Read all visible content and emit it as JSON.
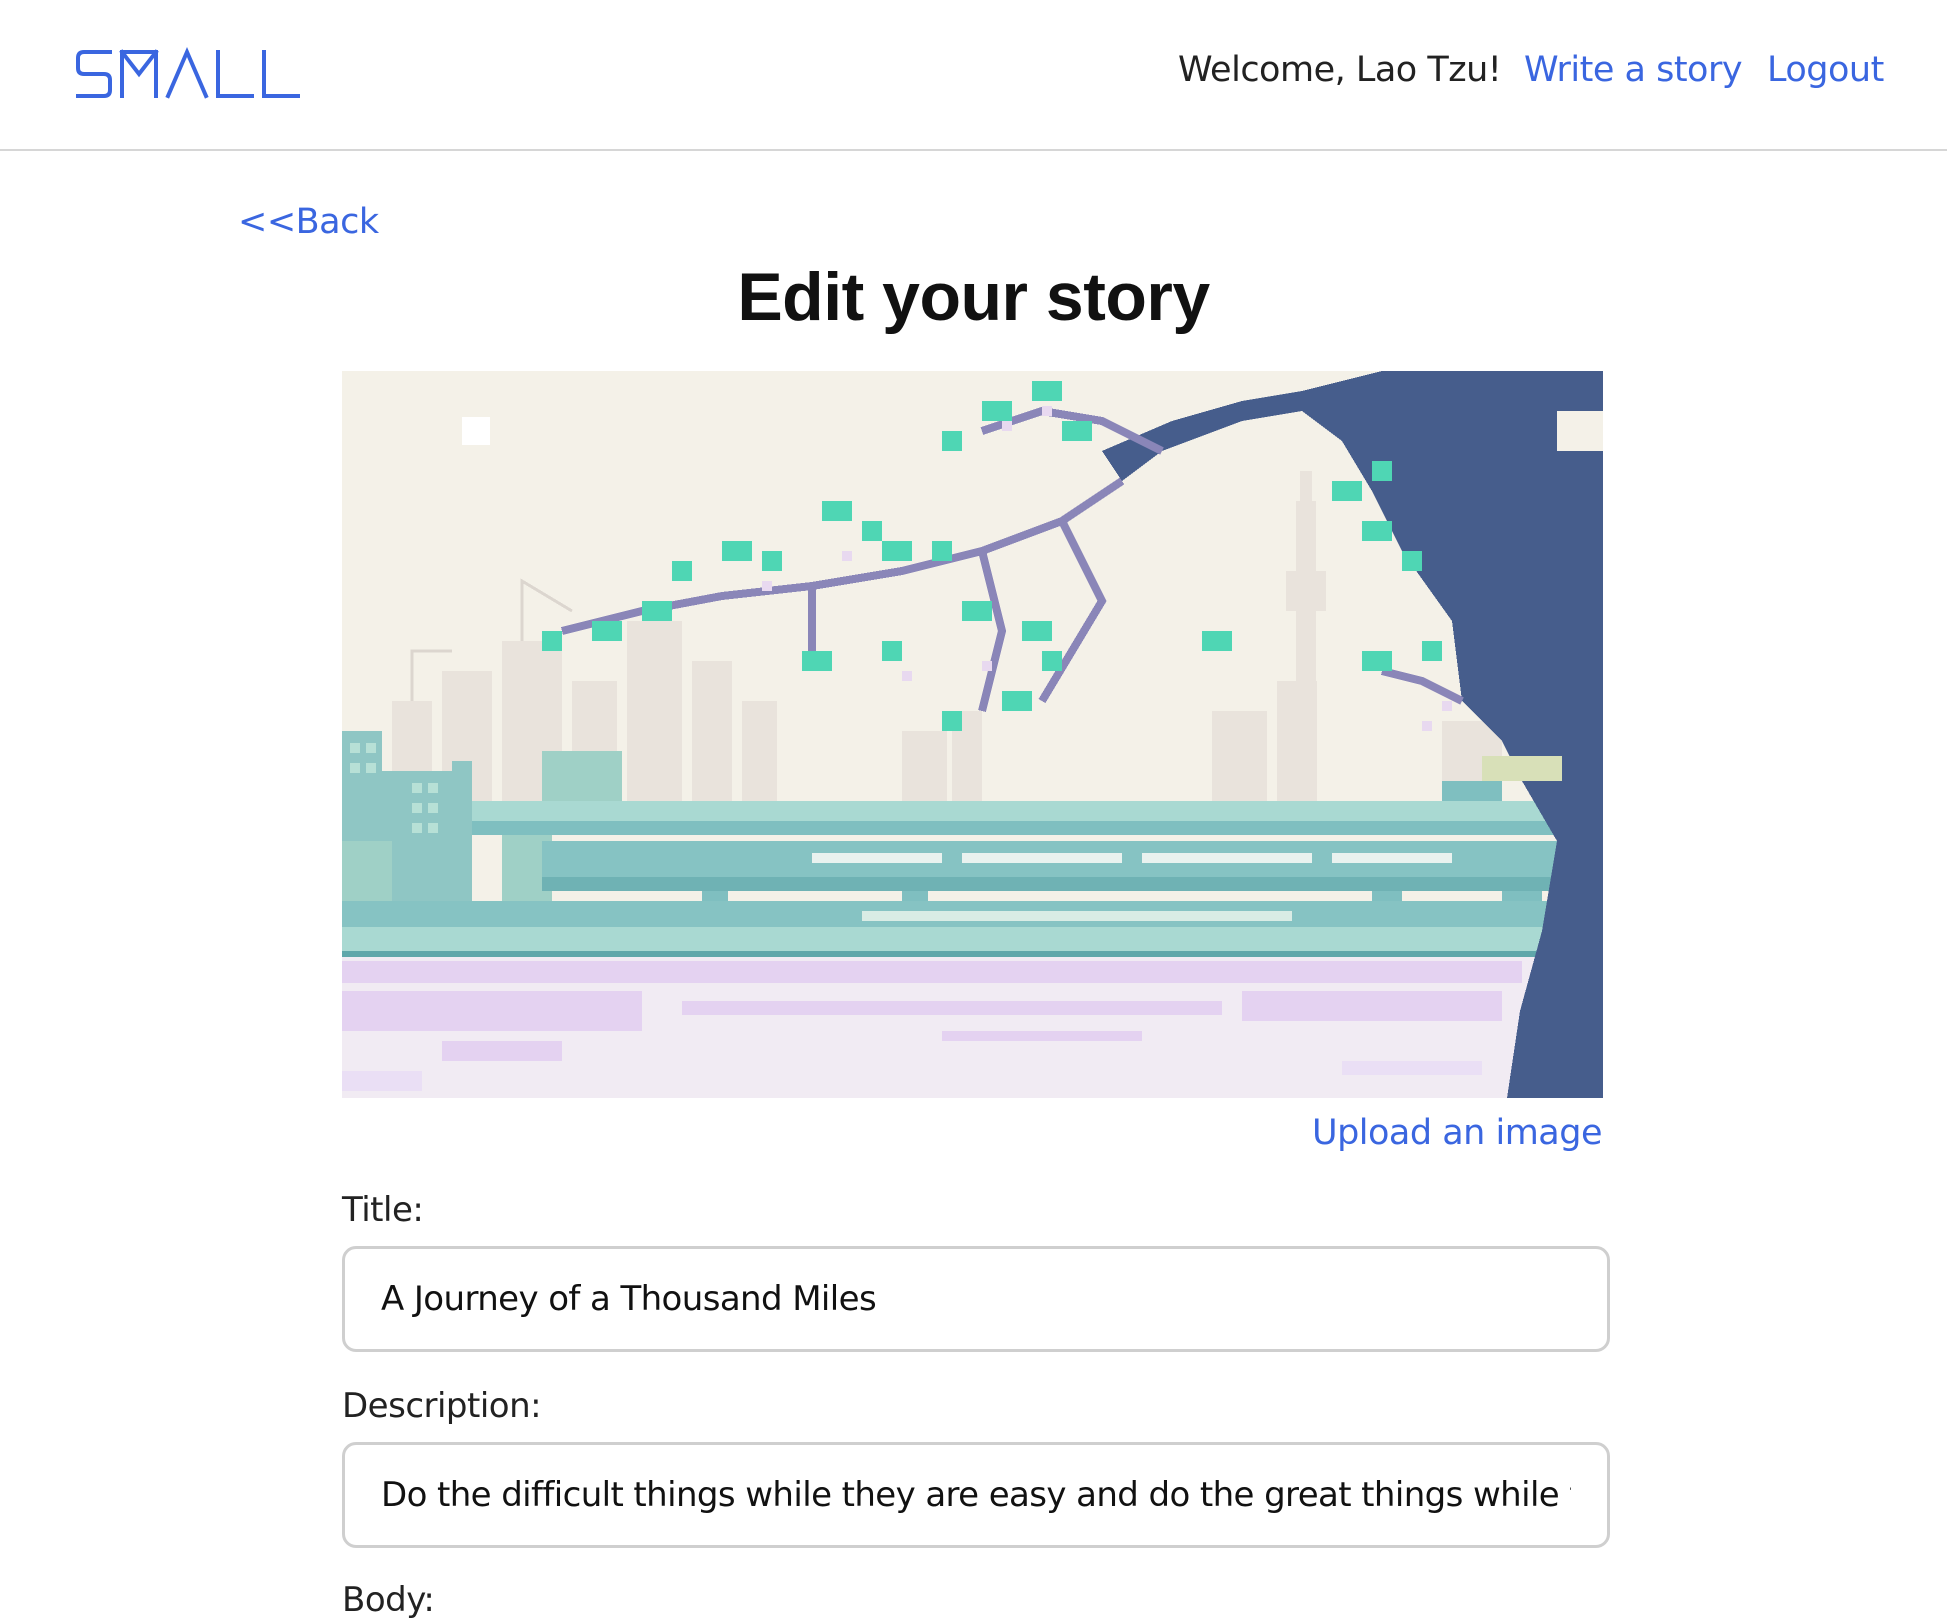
{
  "header": {
    "logo_text": "SMALL",
    "welcome": "Welcome, Lao Tzu!",
    "write_link": "Write a story",
    "logout_link": "Logout"
  },
  "back_link": "<<Back",
  "page_title": "Edit your story",
  "cover_image": {
    "upload_link": "Upload an image"
  },
  "form": {
    "title_label": "Title:",
    "title_value": "A Journey of a Thousand Miles",
    "description_label": "Description:",
    "description_value": "Do the difficult things while they are easy and do the great things while they are small.",
    "body_label": "Body:"
  },
  "colors": {
    "accent": "#3a66e0",
    "border": "#cfcfcf"
  }
}
